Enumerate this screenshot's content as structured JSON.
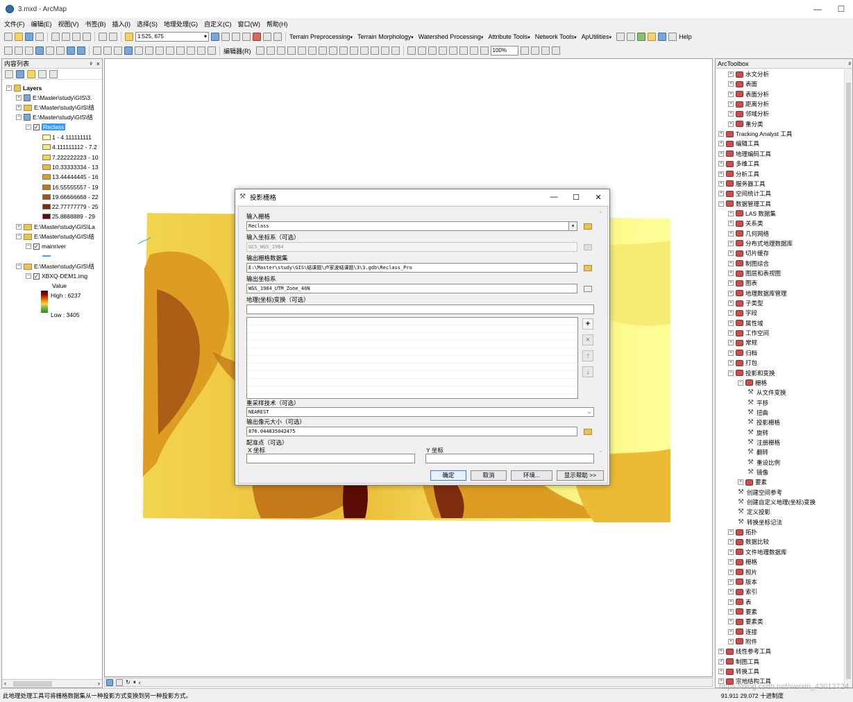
{
  "window": {
    "title": "3.mxd - ArcMap",
    "buttons": [
      "—",
      "☐"
    ]
  },
  "menu": [
    "文件(F)",
    "编辑(E)",
    "视图(V)",
    "书签(B)",
    "插入(I)",
    "选择(S)",
    "地理处理(G)",
    "自定义(C)",
    "窗口(W)",
    "帮助(H)"
  ],
  "toolbar1": {
    "scale": "1:525, 675",
    "menus": [
      "Terrain Preprocessing",
      "Terrain Morphology",
      "Watershed Processing",
      "Attribute Tools",
      "Network Tools",
      "ApUtilities"
    ],
    "help": "Help"
  },
  "toolbar2": {
    "editor": "编辑器(R)",
    "zoom": "100%"
  },
  "toc": {
    "title": "内容列表",
    "pin": "ᵖ",
    "close": "×",
    "root": "Layers",
    "rows": [
      "E:\\Master\\study\\GIS\\3.",
      "E:\\Master\\study\\GIS\\结",
      "E:\\Master\\study\\GIS\\结"
    ],
    "reclass_layer": "Reclass",
    "classes": [
      {
        "label": "1 - 4.111111111",
        "color": "#ffff99"
      },
      {
        "label": "4.111111112 - 7.2",
        "color": "#f7ec73"
      },
      {
        "label": "7.222222223 - 10",
        "color": "#f2d550"
      },
      {
        "label": "10.33333334 - 13",
        "color": "#ebbc33"
      },
      {
        "label": "13.44444445 - 16",
        "color": "#dc9d22"
      },
      {
        "label": "16.55555557 - 19",
        "color": "#c57a1a"
      },
      {
        "label": "19.66666668 - 22",
        "color": "#a65214"
      },
      {
        "label": "22.77777779 - 25",
        "color": "#7f2c0f"
      },
      {
        "label": "25.8888889 - 29",
        "color": "#5a0c05"
      }
    ],
    "rows2": [
      "E:\\Master\\study\\GIS\\La",
      "E:\\Master\\study\\GIS\\结"
    ],
    "mainriver": "mainriver",
    "row3": "E:\\Master\\study\\GIS\\结",
    "dem": "XBXQ-DEM1.img",
    "value_label": "Value",
    "high": "High : 6237",
    "low": "Low : 3405"
  },
  "dialog": {
    "title": "投影栅格",
    "buttons": [
      "—",
      "☐",
      "✕"
    ],
    "input_raster_label": "输入栅格",
    "input_raster": "Reclass",
    "input_crs_label": "输入坐标系（可选）",
    "input_crs": "GCS_WGS_1984",
    "output_raster_label": "输出栅格数据集",
    "output_raster": "E:\\Master\\study\\GIS\\结课题\\卢家波结课题\\3\\3.gdb\\Reclass_Pro",
    "output_crs_label": "输出坐标系",
    "output_crs": "WGS_1984_UTM_Zone_46N",
    "geo_transform_label": "地理(坐标)变换（可选）",
    "geo_transform": "",
    "side_buttons": [
      "+",
      "×",
      "↑",
      "↓"
    ],
    "resample_label": "重采样技术（可选）",
    "resample": "NEAREST",
    "cellsize_label": "输出像元大小（可选）",
    "cellsize": "876.044835042475",
    "register_label": "配准点（可选）",
    "x_label": "X 坐标",
    "y_label": "Y 坐标",
    "x_value": "",
    "y_value": "",
    "ok": "确定",
    "cancel": "取消",
    "env": "环境...",
    "help": "显示帮助 >>"
  },
  "arctoolbox": {
    "title": "ArcToolbox",
    "pin": "ᵖ",
    "items": [
      {
        "label": "水文分析",
        "level": 2,
        "type": "box"
      },
      {
        "label": "表面",
        "level": 2,
        "type": "box"
      },
      {
        "label": "表面分析",
        "level": 2,
        "type": "box"
      },
      {
        "label": "距离分析",
        "level": 2,
        "type": "box"
      },
      {
        "label": "邻域分析",
        "level": 2,
        "type": "box"
      },
      {
        "label": "重分类",
        "level": 2,
        "type": "box"
      },
      {
        "label": "Tracking Analyst 工具",
        "level": 1,
        "type": "box"
      },
      {
        "label": "编辑工具",
        "level": 1,
        "type": "box"
      },
      {
        "label": "地理编码工具",
        "level": 1,
        "type": "box"
      },
      {
        "label": "多维工具",
        "level": 1,
        "type": "box"
      },
      {
        "label": "分析工具",
        "level": 1,
        "type": "box"
      },
      {
        "label": "服务器工具",
        "level": 1,
        "type": "box"
      },
      {
        "label": "空间统计工具",
        "level": 1,
        "type": "box"
      },
      {
        "label": "数据管理工具",
        "level": 1,
        "type": "box",
        "open": true
      },
      {
        "label": "LAS 数据集",
        "level": 2,
        "type": "box"
      },
      {
        "label": "关系类",
        "level": 2,
        "type": "box"
      },
      {
        "label": "几何网络",
        "level": 2,
        "type": "box"
      },
      {
        "label": "分布式地理数据库",
        "level": 2,
        "type": "box"
      },
      {
        "label": "切片缓存",
        "level": 2,
        "type": "box"
      },
      {
        "label": "制图综合",
        "level": 2,
        "type": "box"
      },
      {
        "label": "图层和表视图",
        "level": 2,
        "type": "box"
      },
      {
        "label": "图表",
        "level": 2,
        "type": "box"
      },
      {
        "label": "地理数据库管理",
        "level": 2,
        "type": "box"
      },
      {
        "label": "子类型",
        "level": 2,
        "type": "box"
      },
      {
        "label": "字段",
        "level": 2,
        "type": "box"
      },
      {
        "label": "属性域",
        "level": 2,
        "type": "box"
      },
      {
        "label": "工作空间",
        "level": 2,
        "type": "box"
      },
      {
        "label": "常规",
        "level": 2,
        "type": "box"
      },
      {
        "label": "归档",
        "level": 2,
        "type": "box"
      },
      {
        "label": "打包",
        "level": 2,
        "type": "box"
      },
      {
        "label": "投影和变换",
        "level": 2,
        "type": "box",
        "open": true
      },
      {
        "label": "栅格",
        "level": 3,
        "type": "box",
        "open": true
      },
      {
        "label": "从文件变换",
        "level": 4,
        "type": "tool"
      },
      {
        "label": "平移",
        "level": 4,
        "type": "tool"
      },
      {
        "label": "扭曲",
        "level": 4,
        "type": "tool"
      },
      {
        "label": "投影栅格",
        "level": 4,
        "type": "tool"
      },
      {
        "label": "旋转",
        "level": 4,
        "type": "tool"
      },
      {
        "label": "注册栅格",
        "level": 4,
        "type": "tool"
      },
      {
        "label": "翻转",
        "level": 4,
        "type": "tool"
      },
      {
        "label": "重设比例",
        "level": 4,
        "type": "tool"
      },
      {
        "label": "镜像",
        "level": 4,
        "type": "tool"
      },
      {
        "label": "要素",
        "level": 3,
        "type": "box"
      },
      {
        "label": "创建空间参考",
        "level": 3,
        "type": "tool"
      },
      {
        "label": "创建自定义地理(坐标)变换",
        "level": 3,
        "type": "tool"
      },
      {
        "label": "定义投影",
        "level": 3,
        "type": "tool"
      },
      {
        "label": "转换坐标记法",
        "level": 3,
        "type": "tool"
      },
      {
        "label": "拓扑",
        "level": 2,
        "type": "box"
      },
      {
        "label": "数据比较",
        "level": 2,
        "type": "box"
      },
      {
        "label": "文件地理数据库",
        "level": 2,
        "type": "box"
      },
      {
        "label": "栅格",
        "level": 2,
        "type": "box"
      },
      {
        "label": "照片",
        "level": 2,
        "type": "box"
      },
      {
        "label": "版本",
        "level": 2,
        "type": "box"
      },
      {
        "label": "索引",
        "level": 2,
        "type": "box"
      },
      {
        "label": "表",
        "level": 2,
        "type": "box"
      },
      {
        "label": "要素",
        "level": 2,
        "type": "box"
      },
      {
        "label": "要素类",
        "level": 2,
        "type": "box"
      },
      {
        "label": "连接",
        "level": 2,
        "type": "box"
      },
      {
        "label": "附件",
        "level": 2,
        "type": "box"
      },
      {
        "label": "线性参考工具",
        "level": 1,
        "type": "box"
      },
      {
        "label": "制图工具",
        "level": 1,
        "type": "box"
      },
      {
        "label": "转换工具",
        "level": 1,
        "type": "box"
      },
      {
        "label": "宗地结构工具",
        "level": 1,
        "type": "box"
      }
    ]
  },
  "status": {
    "message": "此地理处理工具可将栅格数据集从一种投影方式变换到另一种投影方式。",
    "coords": "91.911  29.072 十进制度",
    "watermark": "https://blog.csdn.net/weixin_43012724"
  }
}
